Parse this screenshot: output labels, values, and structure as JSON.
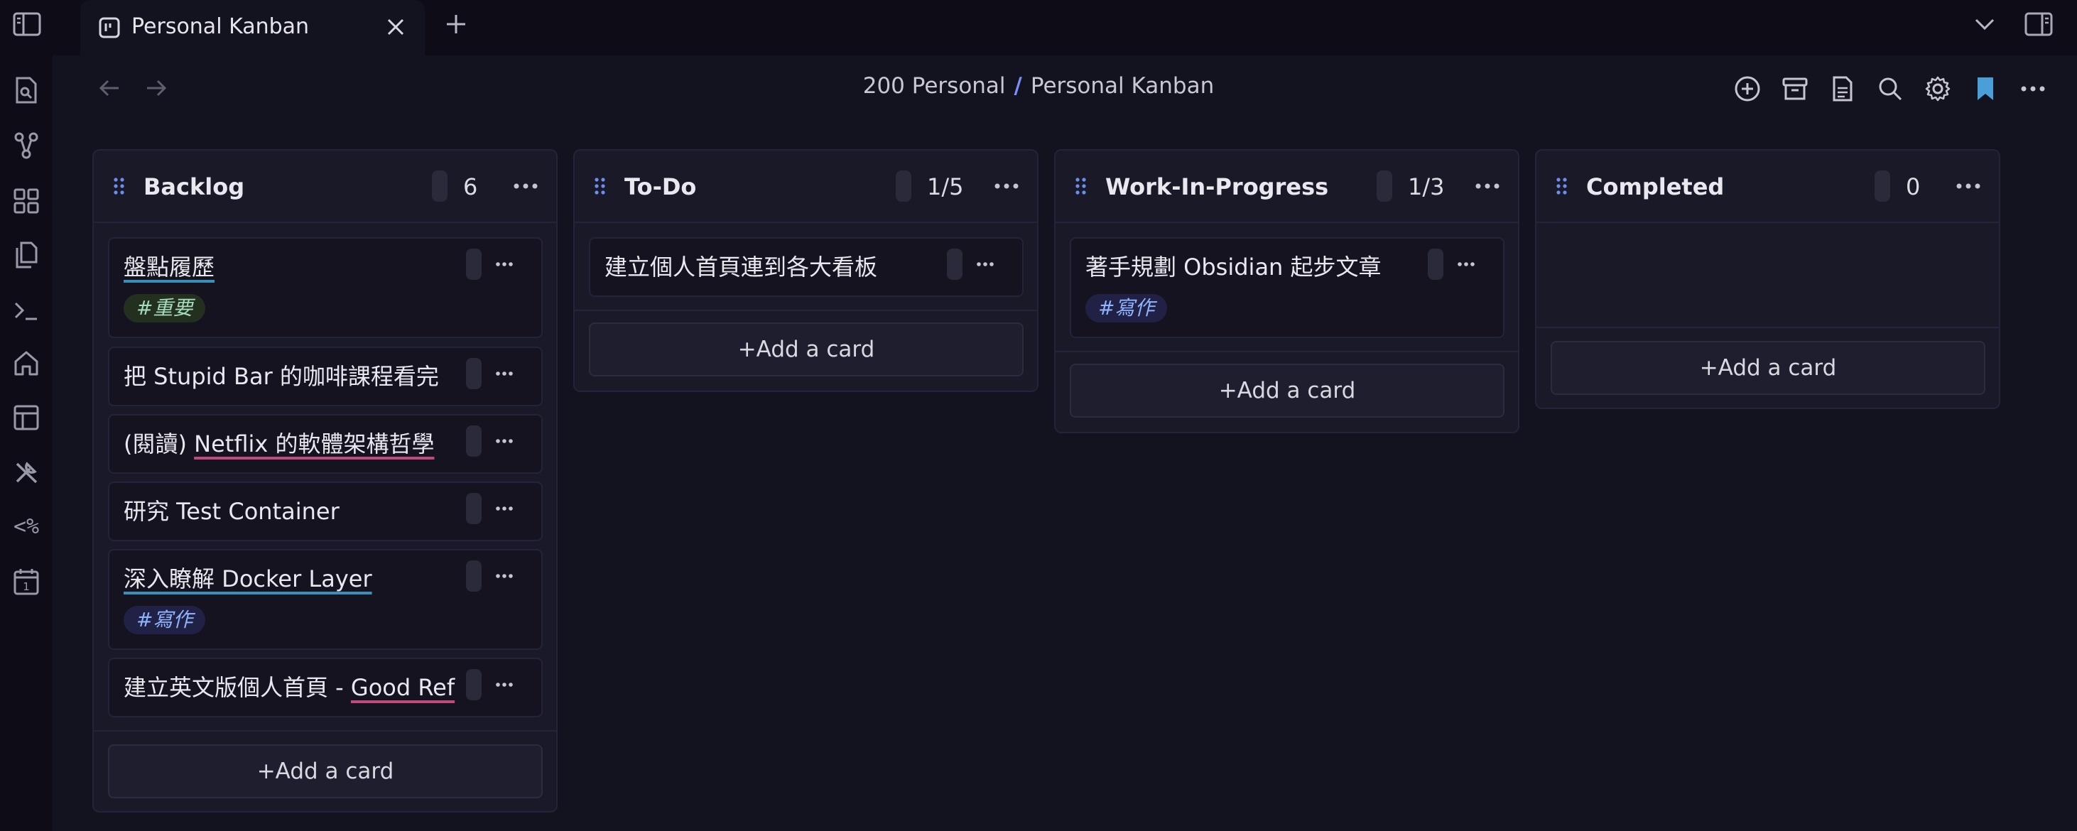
{
  "tab": {
    "title": "Personal Kanban"
  },
  "breadcrumb": {
    "parent": "200 Personal",
    "separator": "/",
    "current": "Personal Kanban"
  },
  "lanes": [
    {
      "title": "Backlog",
      "count": "6",
      "cards": [
        {
          "text": "盤點履歷",
          "tag": "#重要"
        },
        {
          "text": "把 Stupid Bar 的咖啡課程看完"
        },
        {
          "prefix": "(閱讀) ",
          "text": "Netflix 的軟體架構哲學"
        },
        {
          "text": "研究 Test Container"
        },
        {
          "text": "深入瞭解 Docker Layer",
          "tag": "#寫作"
        },
        {
          "prefix": "建立英文版個人首頁 - ",
          "text": "Good Ref"
        }
      ],
      "add_label": "+Add a card"
    },
    {
      "title": "To-Do",
      "count": "1/5",
      "cards": [
        {
          "text": "建立個人首頁連到各大看板"
        }
      ],
      "add_label": "+Add a card"
    },
    {
      "title": "Work-In-Progress",
      "count": "1/3",
      "cards": [
        {
          "text": "著手規劃 Obsidian 起步文章",
          "tag": "#寫作"
        }
      ],
      "add_label": "+Add a card"
    },
    {
      "title": "Completed",
      "count": "0",
      "cards": [],
      "add_label": "+Add a card"
    }
  ],
  "colors": {
    "accent": "#7c8cf8",
    "bookmark": "#4a9fd8",
    "background": "#13121f",
    "lane": "#1a1927"
  },
  "icons": {
    "tabbar": [
      "sidebar-left-icon",
      "kanban-icon",
      "close-icon",
      "plus-icon",
      "chevron-down-icon",
      "sidebar-right-icon"
    ],
    "ribbon": [
      "search-file-icon",
      "graph-icon",
      "blocks-icon",
      "files-icon",
      "terminal-icon",
      "home-icon",
      "layout-icon",
      "tools-icon",
      "templater-icon",
      "calendar-icon"
    ],
    "ribbon_text": {
      "templater": "<%",
      "calendar_day": "1"
    },
    "header": [
      "back-arrow-icon",
      "forward-arrow-icon",
      "add-circle-icon",
      "archive-icon",
      "document-icon",
      "search-icon",
      "settings-gear-icon",
      "bookmark-icon",
      "more-options-icon"
    ]
  }
}
